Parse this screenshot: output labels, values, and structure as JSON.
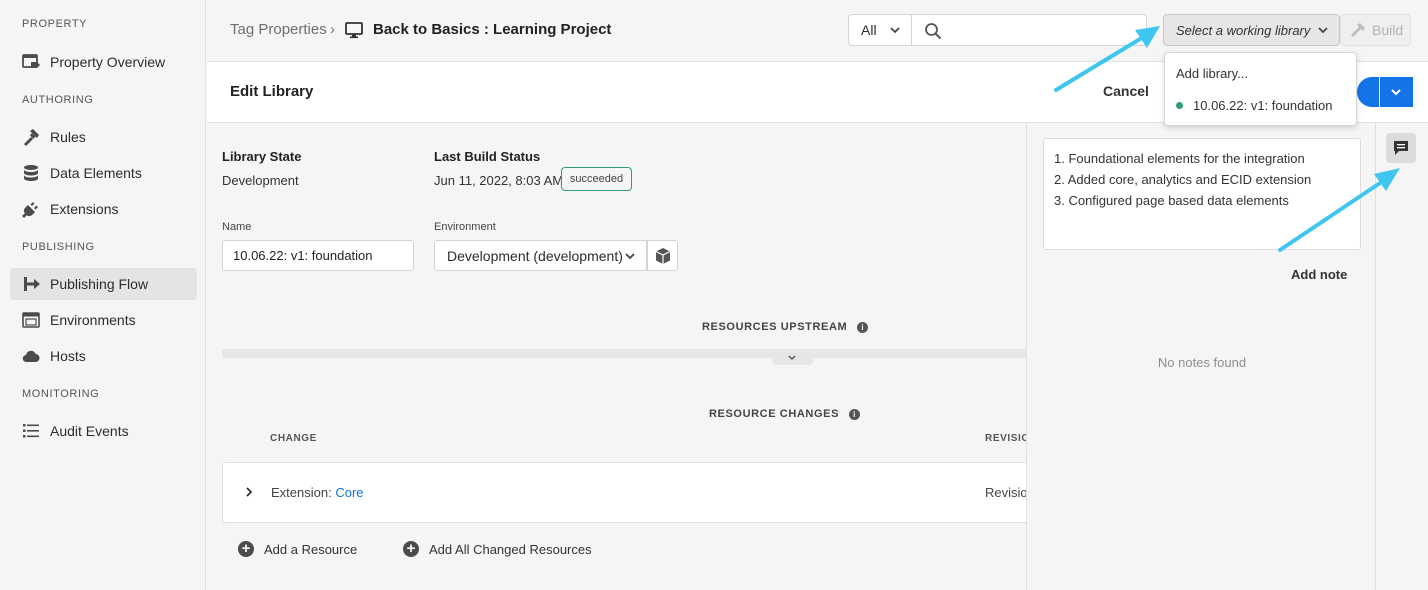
{
  "sidebar": {
    "sections": {
      "property": "PROPERTY",
      "authoring": "AUTHORING",
      "publishing": "PUBLISHING",
      "monitoring": "MONITORING"
    },
    "items": {
      "property_overview": "Property Overview",
      "rules": "Rules",
      "data_elements": "Data Elements",
      "extensions": "Extensions",
      "publishing_flow": "Publishing Flow",
      "environments": "Environments",
      "hosts": "Hosts",
      "audit_events": "Audit Events"
    },
    "active_item": "publishing_flow"
  },
  "header": {
    "breadcrumb_root": "Tag Properties",
    "breadcrumb_separator": "›",
    "project_name": "Back to Basics : Learning Project",
    "search_scope": "All",
    "search_placeholder": "",
    "library_select_label": "Select a working library",
    "build_label": "Build"
  },
  "library_dropdown": {
    "add_library": "Add library...",
    "library_item": "10.06.22: v1: foundation",
    "status_color": "#2d9d78"
  },
  "edit_bar": {
    "title": "Edit Library",
    "cancel_label": "Cancel",
    "primary_color": "#1473e6"
  },
  "library": {
    "state_label": "Library State",
    "state_value": "Development",
    "build_status_label": "Last Build Status",
    "build_status_date": "Jun 11, 2022, 8:03 AM",
    "build_status_badge": "succeeded",
    "name_label": "Name",
    "name_value": "10.06.22: v1: foundation",
    "environment_label": "Environment",
    "environment_value": "Development (development)"
  },
  "resources": {
    "upstream_heading": "RESOURCES UPSTREAM",
    "changes_heading": "RESOURCE CHANGES",
    "columns": {
      "change": "CHANGE",
      "revision": "REVISIO"
    },
    "rows": [
      {
        "type": "Extension:",
        "name": "Core",
        "revision": "Revisio"
      }
    ],
    "add_resource": "Add a Resource",
    "add_all_changed": "Add All Changed Resources"
  },
  "notes": {
    "lines": [
      "1. Foundational elements for the integration",
      "2. Added core, analytics and ECID extension",
      "3. Configured page based data elements"
    ],
    "add_note_label": "Add note",
    "empty_text": "No notes found"
  },
  "annotation_color": "#3ec6ef"
}
